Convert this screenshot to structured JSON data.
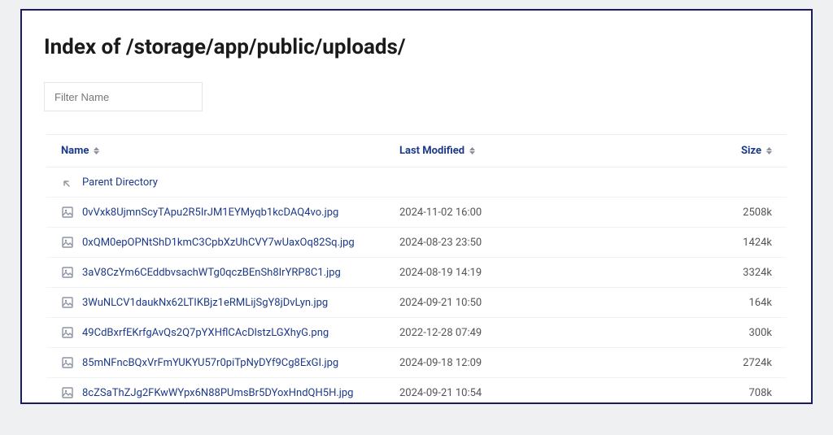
{
  "title": "Index of /storage/app/public/uploads/",
  "filter": {
    "placeholder": "Filter Name"
  },
  "columns": {
    "name": "Name",
    "modified": "Last Modified",
    "size": "Size"
  },
  "parent": {
    "label": "Parent Directory"
  },
  "rows": [
    {
      "name": "0vVxk8UjmnScyTApu2R5IrJM1EYMyqb1kcDAQ4vo.jpg",
      "modified": "2024-11-02 16:00",
      "size": "2508k"
    },
    {
      "name": "0xQM0epOPNtShD1kmC3CpbXzUhCVY7wUaxOq82Sq.jpg",
      "modified": "2024-08-23 23:50",
      "size": "1424k"
    },
    {
      "name": "3aV8CzYm6CEddbvsachWTg0qczBEnSh8IrYRP8C1.jpg",
      "modified": "2024-08-19 14:19",
      "size": "3324k"
    },
    {
      "name": "3WuNLCV1daukNx62LTIKBjz1eRMLijSgY8jDvLyn.jpg",
      "modified": "2024-09-21 10:50",
      "size": "164k"
    },
    {
      "name": "49CdBxrfEKrfgAvQs2Q7pYXHflCAcDlstzLGXhyG.png",
      "modified": "2022-12-28 07:49",
      "size": "300k"
    },
    {
      "name": "85mNFncBQxVrFmYUKYU57r0piTpNyDYf9Cg8ExGI.jpg",
      "modified": "2024-09-18 12:09",
      "size": "2724k"
    },
    {
      "name": "8cZSaThZJg2FKwWYpx6N88PUmsBr5DYoxHndQH5H.jpg",
      "modified": "2024-09-21 10:54",
      "size": "708k"
    }
  ]
}
